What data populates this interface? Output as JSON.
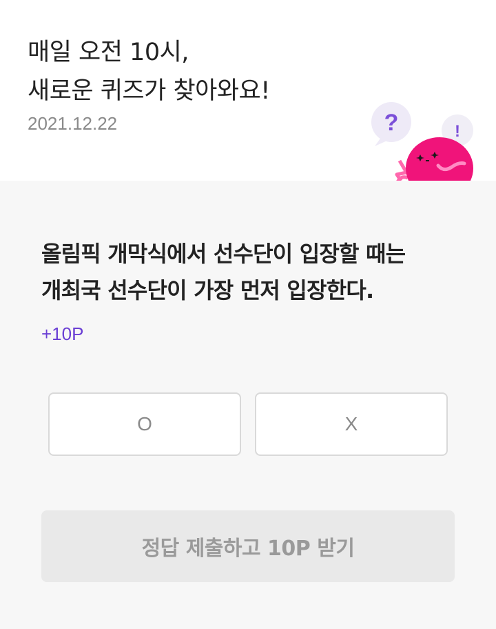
{
  "header": {
    "headline_lines": [
      "매일 오전 10시,",
      "새로운 퀴즈가 찾아와요!"
    ],
    "date": "2021.12.22"
  },
  "mascot": {
    "question_mark": "?",
    "exclamation_mark": "!"
  },
  "quiz": {
    "question_lines": [
      "올림픽 개막식에서 선수단이 입장할 때는",
      "개최국 선수단이 가장 먼저 입장한다."
    ],
    "points": "+10P",
    "options": [
      {
        "label": "O"
      },
      {
        "label": "X"
      }
    ],
    "submit_label": "정답 제출하고 10P 받기"
  },
  "colors": {
    "accent_purple": "#6a3fd4",
    "mascot_pink": "#f0147a",
    "quiz_background": "#f7f7f7"
  }
}
